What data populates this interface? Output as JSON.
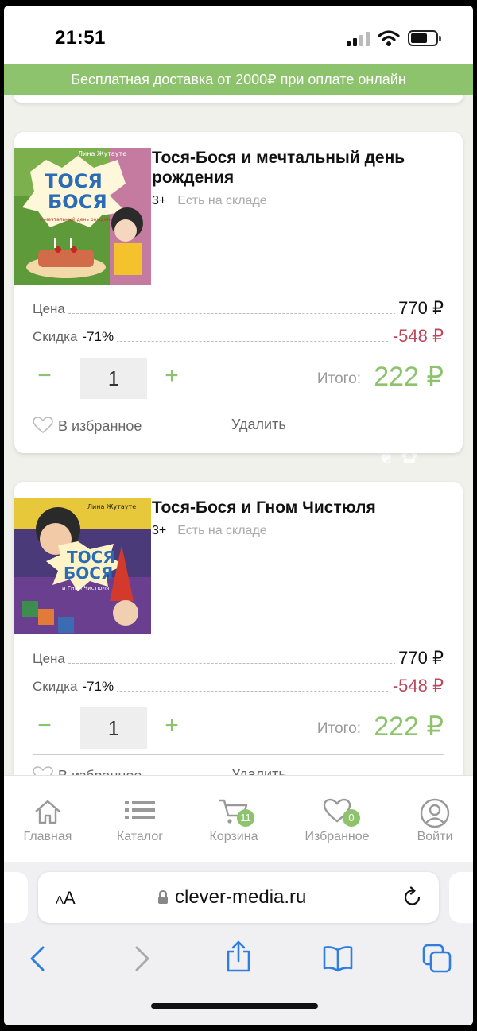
{
  "status": {
    "time": "21:51"
  },
  "promo": {
    "text": "Бесплатная доставка от 2000₽ при оплате онлайн"
  },
  "cart": {
    "items": [
      {
        "title": "Тося-Бося и мечтальный день рождения",
        "age": "3+",
        "stock": "Есть на складе",
        "price_label": "Цена",
        "price": "770 ₽",
        "discount_label": "Скидка",
        "discount_pct": "-71%",
        "discount_value": "-548 ₽",
        "quantity": "1",
        "total_label": "Итого:",
        "total": "222 ₽",
        "fav_label": "В избранное",
        "delete_label": "Удалить",
        "cover": {
          "author": "Лина Жутауте",
          "line1": "ТОСЯ",
          "line2": "БОСЯ",
          "subtitle": "и мечтальный день рождения"
        }
      },
      {
        "title": "Тося-Бося и Гном Чистюля",
        "age": "3+",
        "stock": "Есть на складе",
        "price_label": "Цена",
        "price": "770 ₽",
        "discount_label": "Скидка",
        "discount_pct": "-71%",
        "discount_value": "-548 ₽",
        "quantity": "1",
        "total_label": "Итого:",
        "total": "222 ₽",
        "fav_label": "В избранное",
        "delete_label": "Удалить",
        "cover": {
          "author": "Лина Жутауте",
          "line1": "ТОСЯ",
          "line2": "БОСЯ",
          "subtitle": "и Гном Чистюля"
        }
      }
    ]
  },
  "tabbar": {
    "items": [
      {
        "label": "Главная",
        "icon": "home-icon"
      },
      {
        "label": "Каталог",
        "icon": "list-icon"
      },
      {
        "label": "Корзина",
        "icon": "cart-icon",
        "badge": "11"
      },
      {
        "label": "Избранное",
        "icon": "heart-icon",
        "badge": "0"
      },
      {
        "label": "Войти",
        "icon": "user-icon"
      }
    ]
  },
  "browser": {
    "text_size": "AA",
    "url": "clever-media.ru"
  },
  "colors": {
    "accent": "#8ec36d",
    "discount": "#c0475a",
    "muted": "#999999"
  }
}
